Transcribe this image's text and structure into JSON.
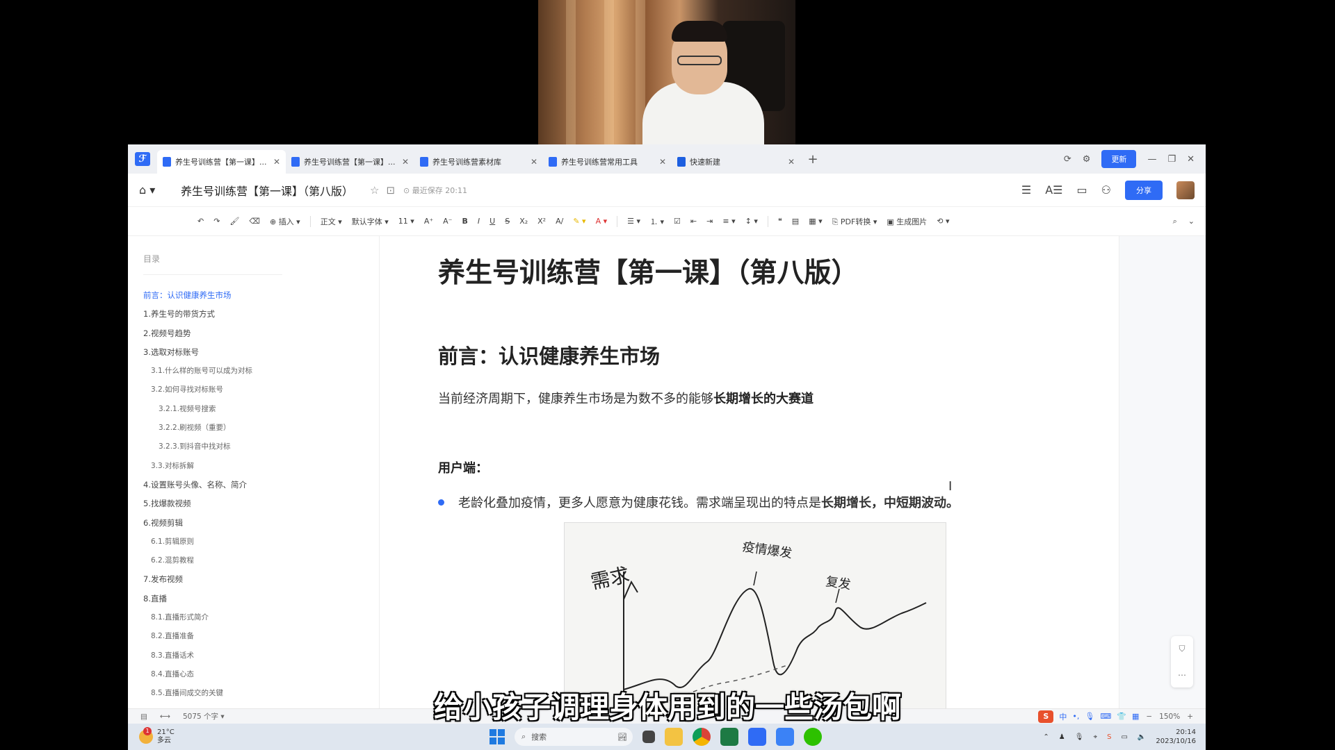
{
  "app": {
    "tabs": [
      {
        "label": "养生号训练营【第一课】...",
        "active": true
      },
      {
        "label": "养生号训练营【第一课】...",
        "active": false
      },
      {
        "label": "养生号训练营素材库",
        "active": false
      },
      {
        "label": "养生号训练营常用工具",
        "active": false
      },
      {
        "label": "快速新建",
        "active": false
      }
    ],
    "update_label": "更新",
    "doc_title": "养生号训练营【第一课】（第八版）",
    "saved_text": "最近保存 20:11",
    "share_label": "分享"
  },
  "toolbar": {
    "insert": "插入",
    "style": "正文",
    "font": "默认字体",
    "size": "11",
    "pdf": "PDF转换",
    "gen_image": "生成图片"
  },
  "outline": {
    "header": "目录",
    "items": [
      {
        "label": "前言：认识健康养生市场",
        "level": 1,
        "active": true
      },
      {
        "label": "1.养生号的带货方式",
        "level": 1
      },
      {
        "label": "2.视频号趋势",
        "level": 1
      },
      {
        "label": "3.选取对标账号",
        "level": 1
      },
      {
        "label": "3.1.什么样的账号可以成为对标",
        "level": 2
      },
      {
        "label": "3.2.如何寻找对标账号",
        "level": 2
      },
      {
        "label": "3.2.1.视频号搜索",
        "level": 3
      },
      {
        "label": "3.2.2.刷视频（重要）",
        "level": 3
      },
      {
        "label": "3.2.3.到抖音中找对标",
        "level": 3
      },
      {
        "label": "3.3.对标拆解",
        "level": 2
      },
      {
        "label": "4.设置账号头像、名称、简介",
        "level": 1
      },
      {
        "label": "5.找爆款视频",
        "level": 1
      },
      {
        "label": "6.视频剪辑",
        "level": 1
      },
      {
        "label": "6.1.剪辑原则",
        "level": 2
      },
      {
        "label": "6.2.混剪教程",
        "level": 2
      },
      {
        "label": "7.发布视频",
        "level": 1
      },
      {
        "label": "8.直播",
        "level": 1
      },
      {
        "label": "8.1.直播形式简介",
        "level": 2
      },
      {
        "label": "8.2.直播准备",
        "level": 2
      },
      {
        "label": "8.3.直播话术",
        "level": 2
      },
      {
        "label": "8.4.直播心态",
        "level": 2
      },
      {
        "label": "8.5.直播间成交的关键",
        "level": 2
      }
    ]
  },
  "document": {
    "h1": "养生号训练营【第一课】（第八版）",
    "h2": "前言：认识健康养生市场",
    "p1_plain": "当前经济周期下，健康养生市场是为数不多的能够",
    "p1_bold": "长期增长的大赛道",
    "user_label": "用户端：",
    "bullet_plain": "老龄化叠加疫情，更多人愿意为健康花钱。需求端呈现出的特点是",
    "bullet_bold": "长期增长，中短期波动。",
    "sketch": {
      "label_left": "需求",
      "label_peak1": "疫情爆发",
      "label_peak2": "复发"
    }
  },
  "status": {
    "word_count": "5075 个字",
    "zoom": "150%"
  },
  "taskbar": {
    "temp": "21°C",
    "weather": "多云",
    "badge": "1",
    "search_placeholder": "搜索",
    "time": "20:14",
    "date": "2023/10/16"
  },
  "subtitle": "给小孩子调理身体用到的一些汤包啊",
  "colors": {
    "accent": "#2f6bf5",
    "toc_active": "#2f6bf5"
  }
}
